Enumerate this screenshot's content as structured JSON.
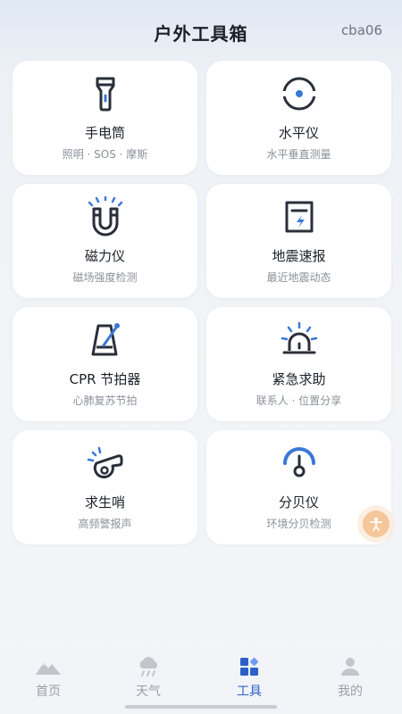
{
  "header": {
    "title": "户外工具箱",
    "user_code": "cba06"
  },
  "tools": [
    {
      "name": "手电筒",
      "desc": "照明 · SOS · 摩斯",
      "icon": "flashlight-icon"
    },
    {
      "name": "水平仪",
      "desc": "水平垂直测量",
      "icon": "level-icon"
    },
    {
      "name": "磁力仪",
      "desc": "磁场强度检测",
      "icon": "magnet-icon"
    },
    {
      "name": "地震速报",
      "desc": "最近地震动态",
      "icon": "earthquake-report-icon"
    },
    {
      "name": "CPR 节拍器",
      "desc": "心肺复苏节拍",
      "icon": "metronome-icon"
    },
    {
      "name": "紧急求助",
      "desc": "联系人 · 位置分享",
      "icon": "alarm-siren-icon"
    },
    {
      "name": "求生哨",
      "desc": "高频警报声",
      "icon": "whistle-icon"
    },
    {
      "name": "分贝仪",
      "desc": "环境分贝检测",
      "icon": "decibel-meter-icon"
    }
  ],
  "tabs": [
    {
      "label": "首页",
      "icon": "mountain-icon",
      "active": false
    },
    {
      "label": "天气",
      "icon": "weather-cloud-icon",
      "active": false
    },
    {
      "label": "工具",
      "icon": "tools-grid-icon",
      "active": true
    },
    {
      "label": "我的",
      "icon": "user-icon",
      "active": false
    }
  ],
  "colors": {
    "accent": "#2b5fc9",
    "icon_dark": "#2a2f3a",
    "float_button": "#f4c699"
  }
}
